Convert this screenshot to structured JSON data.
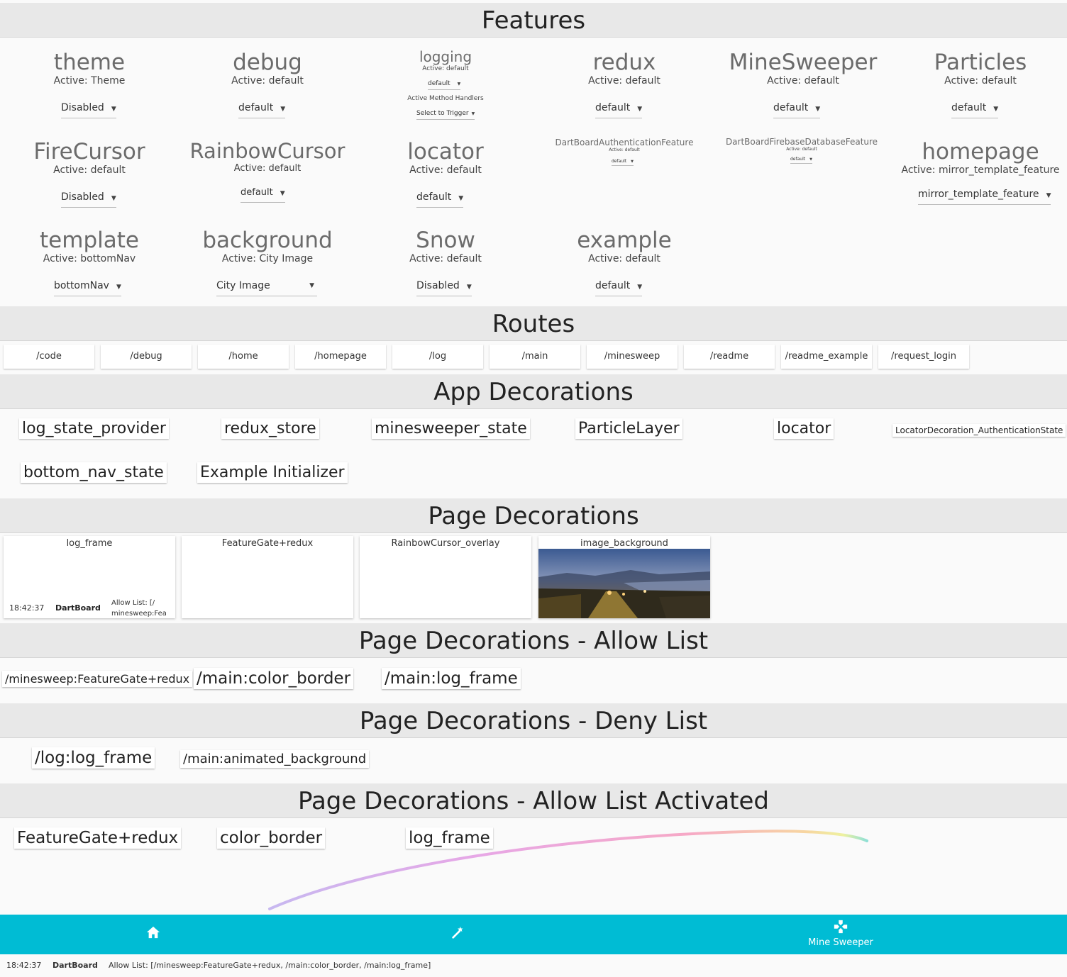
{
  "sections": {
    "features": "Features",
    "routes": "Routes",
    "app_decorations": "App Decorations",
    "page_decorations": "Page Decorations",
    "allow_list": "Page Decorations - Allow List",
    "deny_list": "Page Decorations - Deny List",
    "allow_list_activated": "Page Decorations - Allow List Activated"
  },
  "features": [
    {
      "title": "theme",
      "active": "Active: Theme",
      "value": "Disabled"
    },
    {
      "title": "debug",
      "active": "Active: default",
      "value": "default"
    },
    {
      "title": "logging",
      "active": "Active: default",
      "value": "default",
      "extra_label": "Active Method Handlers",
      "extra_value": "Select to Trigger"
    },
    {
      "title": "redux",
      "active": "Active: default",
      "value": "default"
    },
    {
      "title": "MineSweeper",
      "active": "Active: default",
      "value": "default"
    },
    {
      "title": "Particles",
      "active": "Active: default",
      "value": "default"
    },
    {
      "title": "FireCursor",
      "active": "Active: default",
      "value": "Disabled"
    },
    {
      "title": "RainbowCursor",
      "active": "Active: default",
      "value": "default"
    },
    {
      "title": "locator",
      "active": "Active: default",
      "value": "default"
    },
    {
      "title": "DartBoardAuthenticationFeature",
      "active": "Active: default",
      "value": "default"
    },
    {
      "title": "DartBoardFirebaseDatabaseFeature",
      "active": "Active: default",
      "value": "default"
    },
    {
      "title": "homepage",
      "active": "Active: mirror_template_feature",
      "value": "mirror_template_feature"
    },
    {
      "title": "template",
      "active": "Active: bottomNav",
      "value": "bottomNav"
    },
    {
      "title": "background",
      "active": "Active: City Image",
      "value": "City Image"
    },
    {
      "title": "Snow",
      "active": "Active: default",
      "value": "Disabled"
    },
    {
      "title": "example",
      "active": "Active: default",
      "value": "default"
    }
  ],
  "routes": [
    "/code",
    "/debug",
    "/home",
    "/homepage",
    "/log",
    "/main",
    "/minesweep",
    "/readme",
    "/readme_example",
    "/request_login"
  ],
  "app_decorations": [
    "log_state_provider",
    "redux_store",
    "minesweeper_state",
    "ParticleLayer",
    "locator",
    "LocatorDecoration_AuthenticationState",
    "bottom_nav_state",
    "Example Initializer"
  ],
  "page_decorations": [
    "log_frame",
    "FeatureGate+redux",
    "RainbowCursor_overlay",
    "image_background"
  ],
  "log_frame_card": {
    "time": "18:42:37",
    "name": "DartBoard",
    "allow": "Allow List: [/\nminesweep:Fea"
  },
  "allow_list": [
    "/minesweep:FeatureGate+redux",
    "/main:color_border",
    "/main:log_frame"
  ],
  "deny_list": [
    "/log:log_frame",
    "/main:animated_background"
  ],
  "allow_list_activated": [
    "FeatureGate+redux",
    "color_border",
    "log_frame"
  ],
  "bottom_nav": {
    "items": [
      {
        "icon": "home-icon",
        "label": ""
      },
      {
        "icon": "wand-icon",
        "label": ""
      },
      {
        "icon": "game-controller-icon",
        "label": "Mine Sweeper"
      }
    ],
    "color": "#00bcd4"
  },
  "status_bar": {
    "time": "18:42:37",
    "name": "DartBoard",
    "allow": "Allow List: [/minesweep:FeatureGate+redux, /main:color_border, /main:log_frame]"
  }
}
